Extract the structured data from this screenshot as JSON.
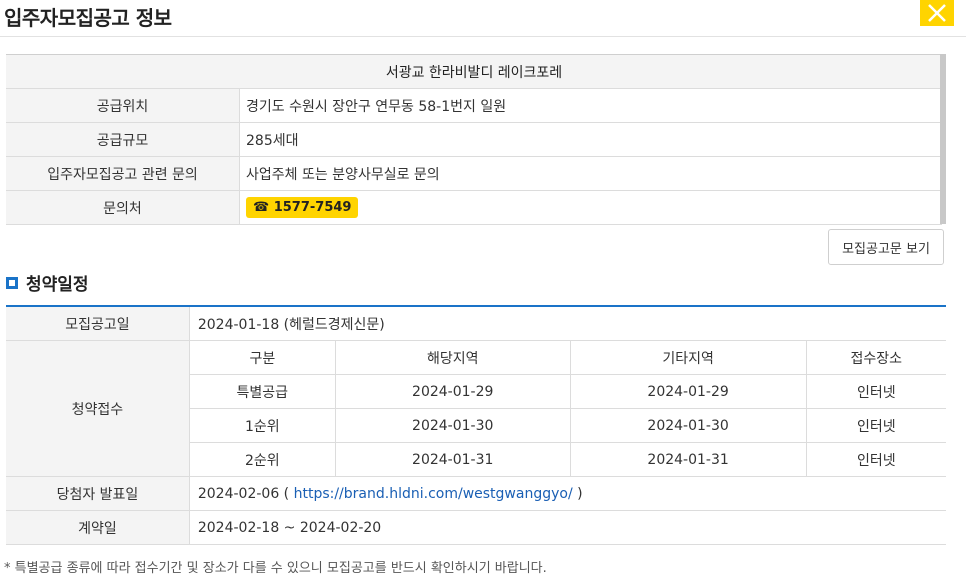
{
  "window": {
    "title": "입주자모집공고 정보"
  },
  "info": {
    "complex_name": "서광교 한라비발디 레이크포레",
    "rows": [
      {
        "label": "공급위치",
        "value": "경기도 수원시 장안구 연무동 58-1번지 일원"
      },
      {
        "label": "공급규모",
        "value": "285세대"
      },
      {
        "label": "입주자모집공고 관련 문의",
        "value": "사업주체 또는 분양사무실로 문의"
      }
    ],
    "contact_label": "문의처",
    "contact_phone": "☎ 1577-7549"
  },
  "notice_button": "모집공고문 보기",
  "schedule": {
    "section_title": "청약일정",
    "announce_label": "모집공고일",
    "announce_value": "2024-01-18 (헤럴드경제신문)",
    "receipt_label": "청약접수",
    "headers": [
      "구분",
      "해당지역",
      "기타지역",
      "접수장소"
    ],
    "rows": [
      [
        "특별공급",
        "2024-01-29",
        "2024-01-29",
        "인터넷"
      ],
      [
        "1순위",
        "2024-01-30",
        "2024-01-30",
        "인터넷"
      ],
      [
        "2순위",
        "2024-01-31",
        "2024-01-31",
        "인터넷"
      ]
    ],
    "winner_label": "당첨자 발표일",
    "winner_date": "2024-02-06 (",
    "winner_link": "https://brand.hldni.com/westgwanggyo/",
    "winner_close": " )",
    "contract_label": "계약일",
    "contract_value": "2024-02-18 ~ 2024-02-20"
  },
  "footnote": "* 특별공급 종류에 따라 접수기간 및 장소가 다를 수 있으니 모집공고를 반드시 확인하시기 바랍니다.",
  "colors": {
    "accent": "#1a73c8",
    "highlight": "#ffd400"
  }
}
